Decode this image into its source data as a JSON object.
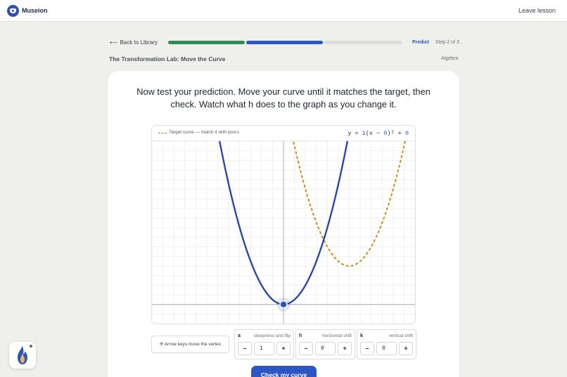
{
  "app": {
    "name": "Museion",
    "leave_label": "Leave lesson"
  },
  "nav": {
    "back_label": "Back to Library"
  },
  "progress": {
    "segments": 3,
    "completed": 2,
    "phase_label": "Predict",
    "step_label": "Step 2 of 3"
  },
  "lesson": {
    "title": "The Transformation Lab: Move the Curve",
    "subject": "Algebra"
  },
  "instruction": "Now test your prediction. Move your curve until it matches the target, then check. Watch what h does to the graph as you change it.",
  "graph": {
    "legend_label": "Target curve — match it with yours",
    "equation": {
      "prefix": "y = ",
      "a": "1",
      "mid1": "(x − ",
      "h": "0",
      "mid2": ")² + ",
      "k": "0"
    },
    "x_range": [
      -6,
      6
    ],
    "y_range": [
      -1,
      8.5
    ],
    "user_curve": {
      "a": 1,
      "h": 0,
      "k": 0,
      "color": "#2a46ad"
    },
    "target_curve": {
      "a": 1,
      "h": 3,
      "k": 2,
      "color": "#c98d1e",
      "style": "dashed"
    },
    "vertex_handle": {
      "x": 0,
      "y": 0,
      "color": "#2f55c5"
    }
  },
  "controls": {
    "hint": "✣ Arrow keys move the vertex",
    "params": [
      {
        "name": "a",
        "desc": "steepness and flip",
        "value": "1",
        "minus": "–",
        "plus": "+"
      },
      {
        "name": "h",
        "desc": "horizontal shift",
        "value": "0",
        "minus": "–",
        "plus": "+"
      },
      {
        "name": "k",
        "desc": "vertical shift",
        "value": "0",
        "minus": "–",
        "plus": "+"
      }
    ]
  },
  "check_label": "Check my curve",
  "colors": {
    "accent": "#2f55c5",
    "done": "#2e8b57",
    "target": "#c98d1e",
    "user_curve": "#2a46ad"
  },
  "icons": {
    "logo": "museion-logo-icon",
    "back": "arrow-left-icon",
    "avatar": "flame-avatar-icon"
  }
}
